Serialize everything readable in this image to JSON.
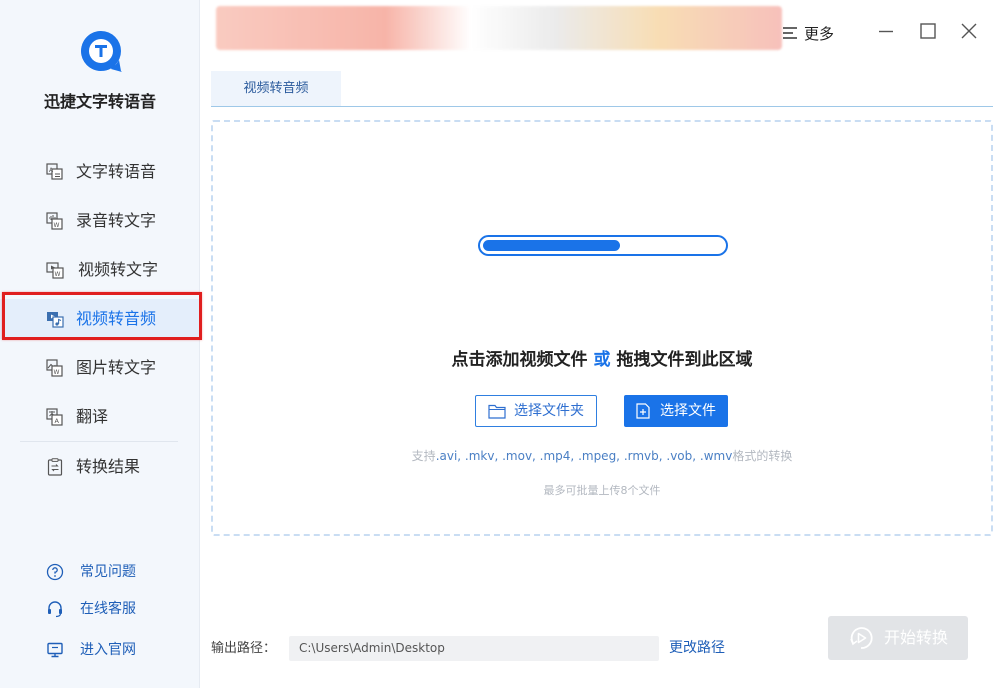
{
  "app": {
    "name": "迅捷文字转语音"
  },
  "sidebar": {
    "items": [
      {
        "label": "文字转语音",
        "icon": "text-to-speech-icon"
      },
      {
        "label": "录音转文字",
        "icon": "audio-to-text-icon"
      },
      {
        "label": "视频转文字",
        "icon": "video-to-text-icon"
      },
      {
        "label": "视频转音频",
        "icon": "video-to-audio-icon",
        "active": true
      },
      {
        "label": "图片转文字",
        "icon": "image-to-text-icon"
      },
      {
        "label": "翻译",
        "icon": "translate-icon"
      },
      {
        "label": "转换结果",
        "icon": "result-icon"
      }
    ],
    "footer": [
      {
        "label": "常见问题",
        "icon": "help-icon"
      },
      {
        "label": "在线客服",
        "icon": "headset-icon"
      },
      {
        "label": "进入官网",
        "icon": "monitor-icon"
      }
    ]
  },
  "titlebar": {
    "more_label": "更多"
  },
  "tabs": [
    {
      "label": "视频转音频"
    }
  ],
  "dropzone": {
    "progress": 0.57,
    "message_part1": "点击添加视频文件",
    "message_or": "或",
    "message_part2": "拖拽文件到此区域",
    "select_folder_label": "选择文件夹",
    "select_file_label": "选择文件",
    "formats_prefix": "支持",
    "formats_list": ".avi, .mkv, .mov, .mp4, .mpeg, .rmvb, .vob, .wmv",
    "formats_suffix": "格式的转换",
    "limit_text": "最多可批量上传8个文件"
  },
  "output": {
    "label": "输出路径：",
    "path": "C:\\Users\\Admin\\Desktop",
    "change_label": "更改路径"
  },
  "start_button": {
    "label": "开始转换"
  },
  "colors": {
    "accent": "#1a73e8",
    "highlight": "#e01e1e",
    "link": "#1f5fb8"
  }
}
